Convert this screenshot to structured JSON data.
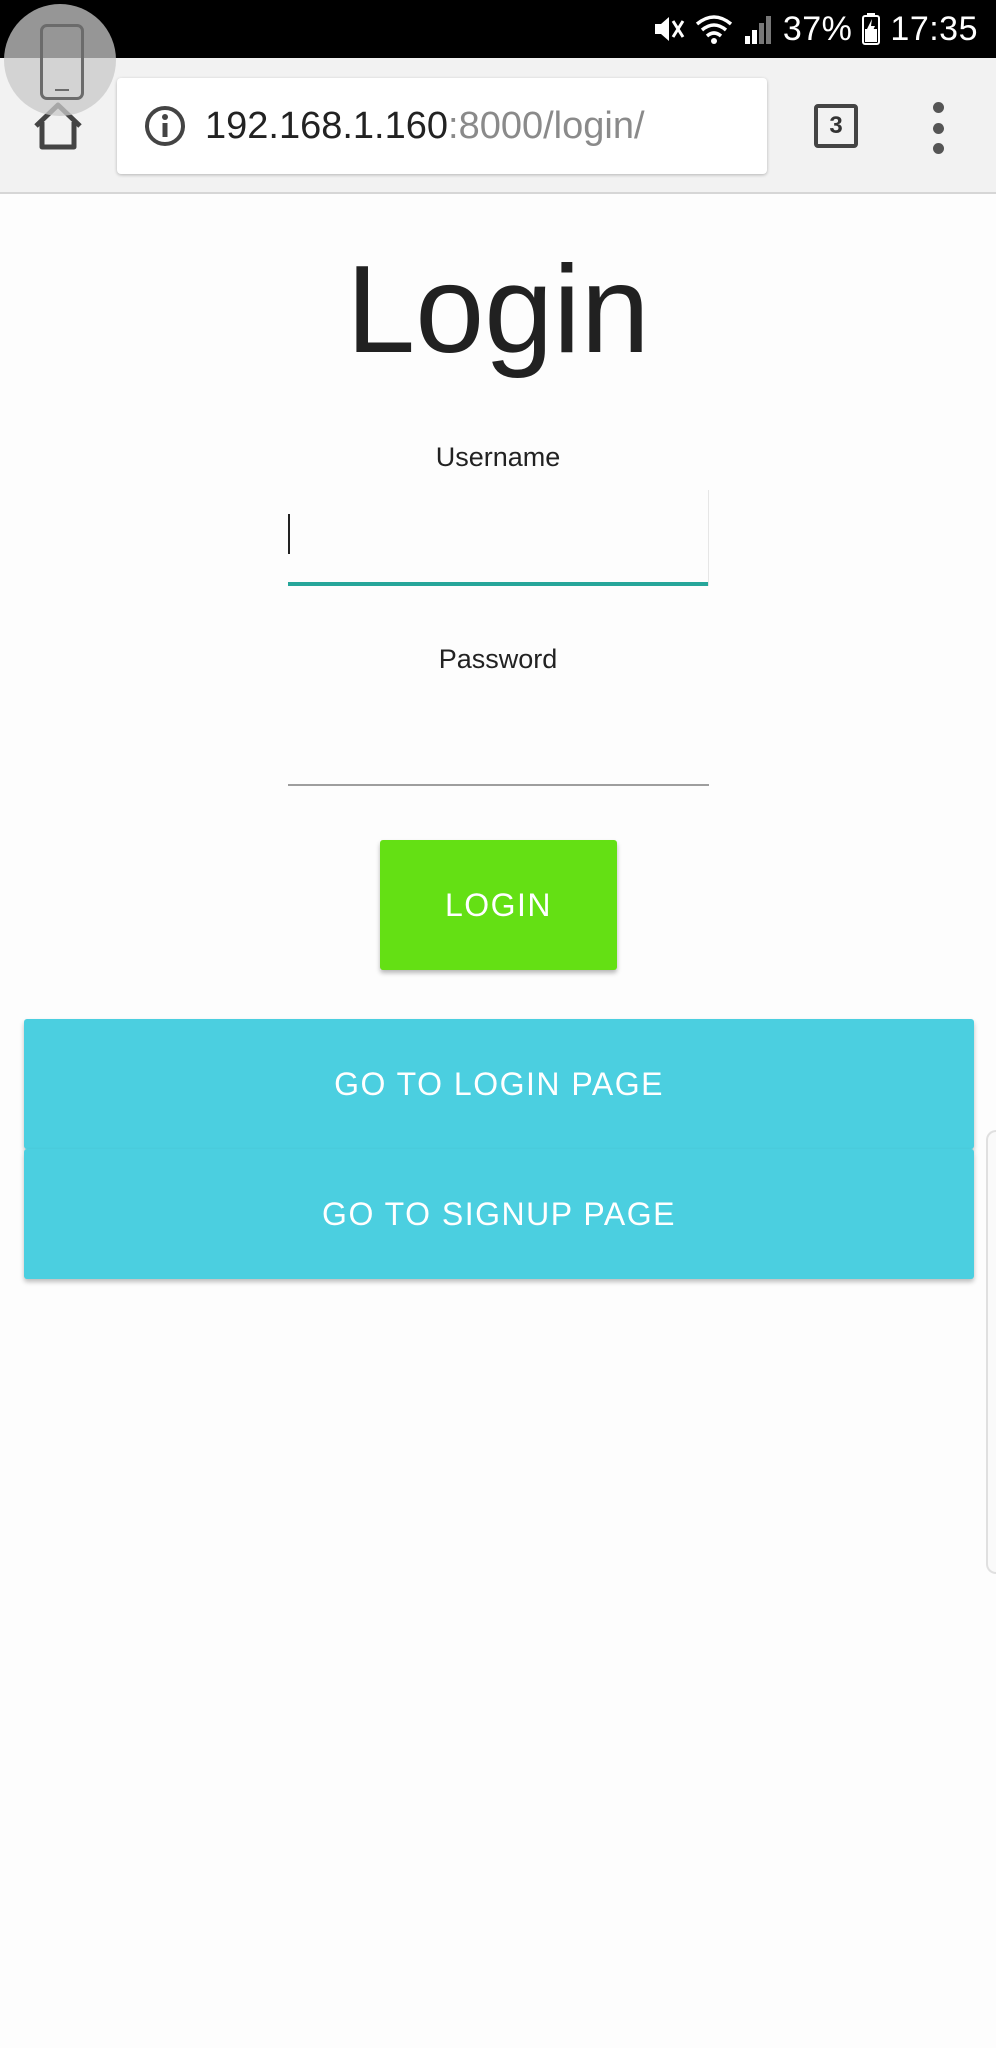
{
  "status_bar": {
    "battery": "37%",
    "time": "17:35",
    "icons": [
      "mute-icon",
      "wifi-icon",
      "signal-icon",
      "battery-charging-icon"
    ]
  },
  "browser": {
    "url_host": "192.168.1.160",
    "url_path": ":8000/login/",
    "tab_count": "3",
    "icons": [
      "home-icon",
      "info-icon",
      "more-vert-icon"
    ]
  },
  "page": {
    "title": "Login",
    "username_label": "Username",
    "username_value": "",
    "password_label": "Password",
    "password_value": "",
    "login_button": "LOGIN",
    "goto_login": "GO TO LOGIN PAGE",
    "goto_signup": "GO TO SIGNUP PAGE"
  },
  "colors": {
    "login_button": "#64e014",
    "nav_button": "#4bcfe0",
    "active_underline": "#26a69a"
  }
}
